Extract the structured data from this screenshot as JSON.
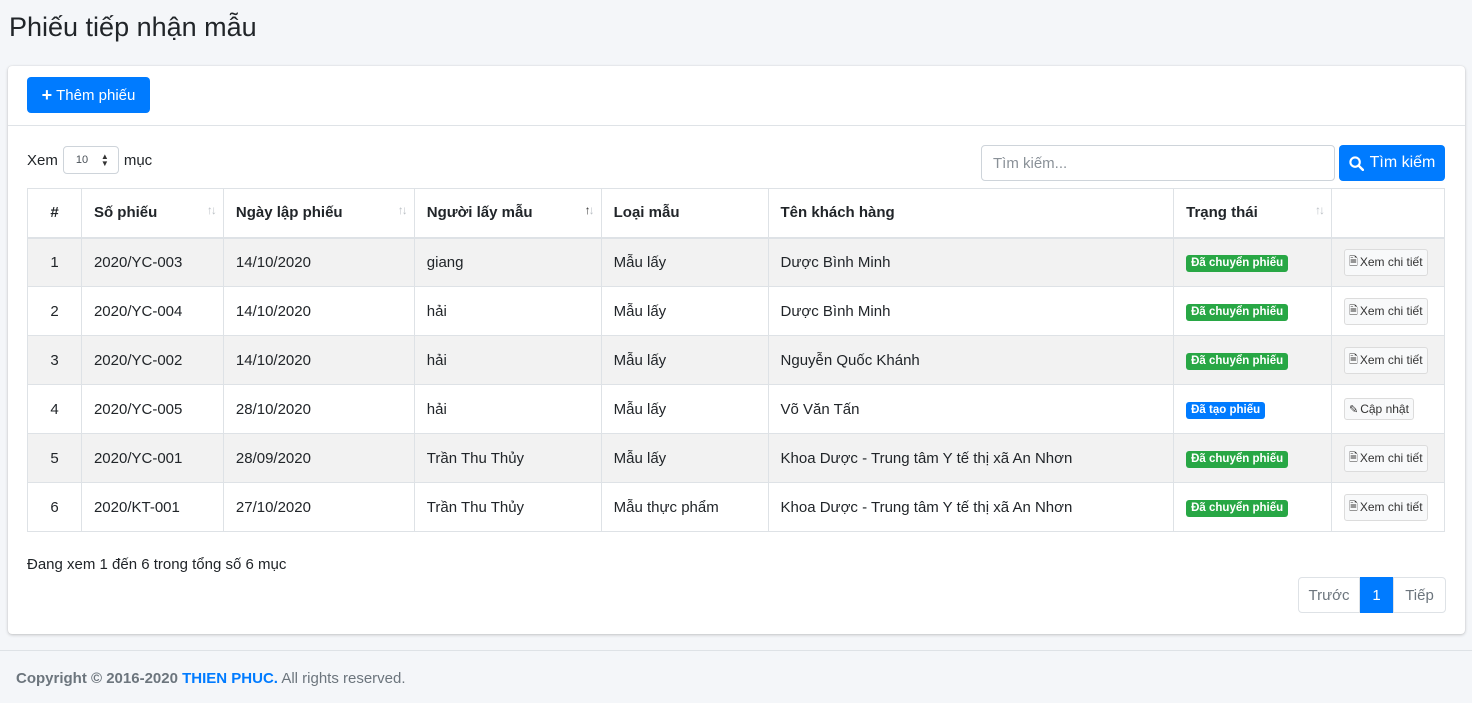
{
  "page": {
    "title": "Phiếu tiếp nhận mẫu"
  },
  "toolbar": {
    "add_label": "Thêm phiếu"
  },
  "length": {
    "prefix": "Xem",
    "value": "10",
    "suffix": "mục"
  },
  "search": {
    "placeholder": "Tìm kiếm...",
    "button_label": "Tìm kiếm"
  },
  "table": {
    "headers": [
      "#",
      "Số phiếu",
      "Ngày lập phiếu",
      "Người lấy mẫu",
      "Loại mẫu",
      "Tên khách hàng",
      "Trạng thái",
      ""
    ],
    "rows": [
      {
        "num": "1",
        "so_phieu": "2020/YC-003",
        "ngay": "14/10/2020",
        "nguoi": "giang",
        "loai": "Mẫu lấy",
        "khach": "Dược Bình Minh",
        "status": "Đã chuyển phiếu",
        "action": "Xem chi tiết"
      },
      {
        "num": "2",
        "so_phieu": "2020/YC-004",
        "ngay": "14/10/2020",
        "nguoi": "hải",
        "loai": "Mẫu lấy",
        "khach": "Dược Bình Minh",
        "status": "Đã chuyển phiếu",
        "action": "Xem chi tiết"
      },
      {
        "num": "3",
        "so_phieu": "2020/YC-002",
        "ngay": "14/10/2020",
        "nguoi": "hải",
        "loai": "Mẫu lấy",
        "khach": "Nguyễn Quốc Khánh",
        "status": "Đã chuyển phiếu",
        "action": "Xem chi tiết"
      },
      {
        "num": "4",
        "so_phieu": "2020/YC-005",
        "ngay": "28/10/2020",
        "nguoi": "hải",
        "loai": "Mẫu lấy",
        "khach": "Võ Văn Tấn",
        "status": "Đã tạo phiếu",
        "action": "Cập nhật"
      },
      {
        "num": "5",
        "so_phieu": "2020/YC-001",
        "ngay": "28/09/2020",
        "nguoi": "Trần Thu Thủy",
        "loai": "Mẫu lấy",
        "khach": "Khoa Dược - Trung tâm Y tế thị xã An Nhơn",
        "status": "Đã chuyển phiếu",
        "action": "Xem chi tiết"
      },
      {
        "num": "6",
        "so_phieu": "2020/KT-001",
        "ngay": "27/10/2020",
        "nguoi": "Trần Thu Thủy",
        "loai": "Mẫu thực phẩm",
        "khach": "Khoa Dược - Trung tâm Y tế thị xã An Nhơn",
        "status": "Đã chuyển phiếu",
        "action": "Xem chi tiết"
      }
    ]
  },
  "info": "Đang xem 1 đến 6 trong tổng số 6 mục",
  "pagination": {
    "prev": "Trước",
    "current": "1",
    "next": "Tiếp"
  },
  "footer": {
    "copyright": "Copyright © 2016-2020",
    "brand": "THIEN PHUC.",
    "rights": "All rights reserved."
  },
  "colors": {
    "primary": "#007bff",
    "success": "#28a745"
  }
}
